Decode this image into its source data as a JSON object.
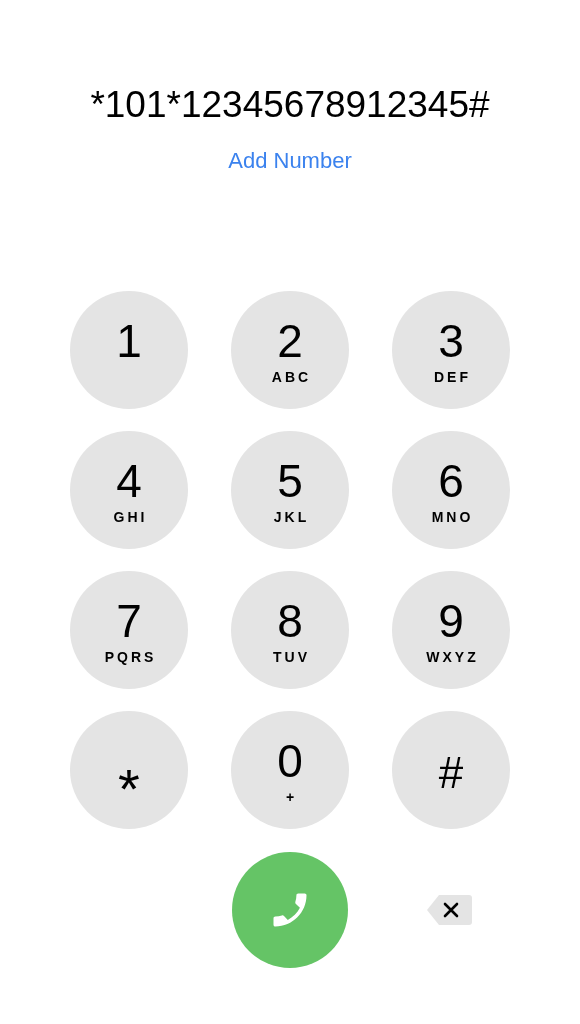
{
  "dialed_number": "*101*12345678912345#",
  "add_number_link": "Add Number",
  "keypad": [
    {
      "kind": "digit",
      "digit": "1"
    },
    {
      "kind": "digit",
      "digit": "2",
      "letters": "ABC"
    },
    {
      "kind": "digit",
      "digit": "3",
      "letters": "DEF"
    },
    {
      "kind": "digit",
      "digit": "4",
      "letters": "GHI"
    },
    {
      "kind": "digit",
      "digit": "5",
      "letters": "JKL"
    },
    {
      "kind": "digit",
      "digit": "6",
      "letters": "MNO"
    },
    {
      "kind": "digit",
      "digit": "7",
      "letters": "PQRS"
    },
    {
      "kind": "digit",
      "digit": "8",
      "letters": "TUV"
    },
    {
      "kind": "digit",
      "digit": "9",
      "letters": "WXYZ"
    },
    {
      "kind": "star",
      "digit": "*"
    },
    {
      "kind": "digit",
      "digit": "0",
      "letters": "+"
    },
    {
      "kind": "symbol",
      "digit": "#"
    }
  ]
}
